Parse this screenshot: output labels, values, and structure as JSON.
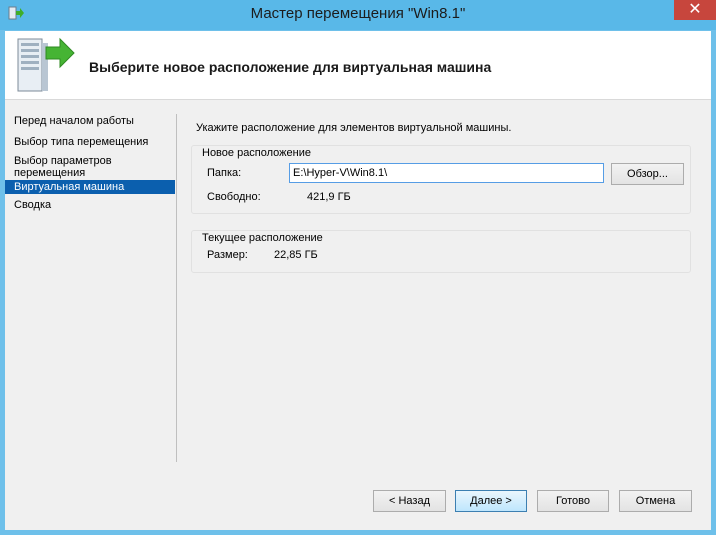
{
  "window": {
    "title": "Мастер перемещения \"Win8.1\"",
    "close_label": "✕"
  },
  "header": {
    "title": "Выберите новое расположение для виртуальная машина"
  },
  "nav": {
    "items": [
      {
        "label": "Перед началом работы"
      },
      {
        "label": "Выбор типа перемещения"
      },
      {
        "label": "Выбор параметров перемещения"
      },
      {
        "label": "Виртуальная машина"
      },
      {
        "label": "Сводка"
      }
    ]
  },
  "main": {
    "instruction": "Укажите расположение для элементов виртуальной машины.",
    "new_location": {
      "label": "Новое расположение",
      "folder_label": "Папка:",
      "folder_value": "E:\\Hyper-V\\Win8.1\\",
      "browse_label": "Обзор...",
      "free_label": "Свободно:",
      "free_value": "421,9 ГБ"
    },
    "current_location": {
      "label": "Текущее расположение",
      "size_label": "Размер:",
      "size_value": "22,85 ГБ"
    }
  },
  "footer": {
    "back_label": "< Назад",
    "next_label": "Далее >",
    "finish_label": "Готово",
    "cancel_label": "Отмена"
  },
  "colors": {
    "titlebar": "#59b8e8",
    "selection": "#0b5fae",
    "close": "#c7463d"
  }
}
